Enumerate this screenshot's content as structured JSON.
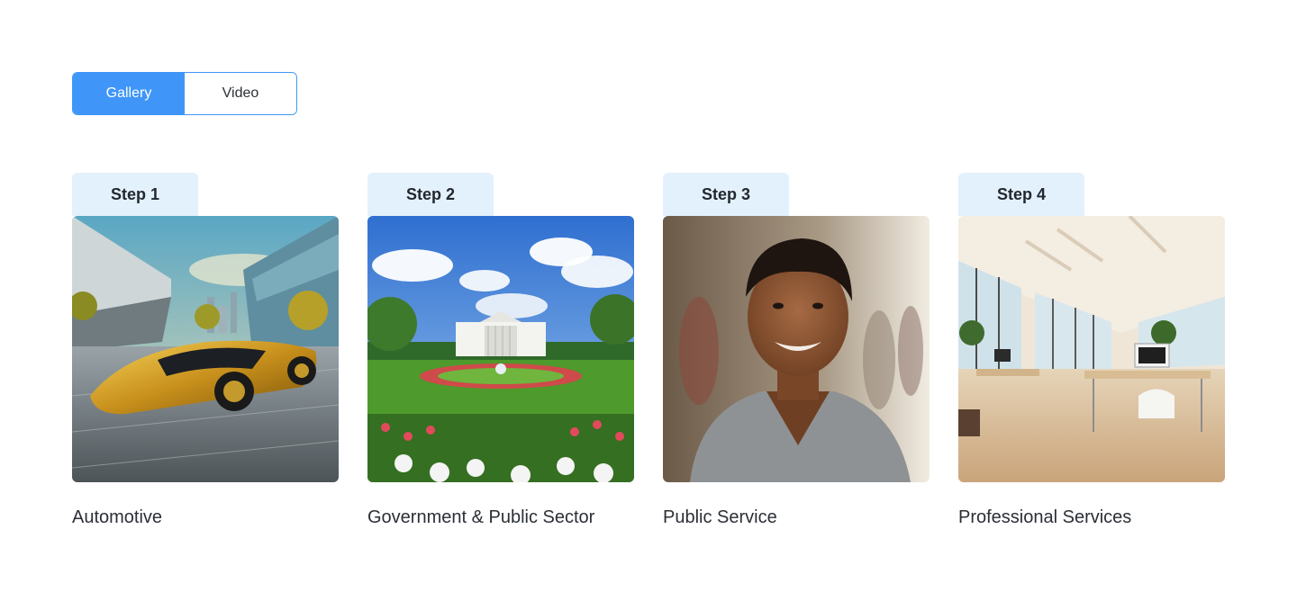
{
  "tabs": {
    "gallery_label": "Gallery",
    "video_label": "Video",
    "active": "Gallery"
  },
  "colors": {
    "accent": "#3f96f8",
    "step_tab_bg": "#e3f1fd",
    "text": "#2b2f36"
  },
  "cards": [
    {
      "step": "Step 1",
      "title": "Automotive",
      "image": "futuristic-gold-car-photo"
    },
    {
      "step": "Step 2",
      "title": "Government & Public Sector",
      "image": "government-building-garden-photo"
    },
    {
      "step": "Step 3",
      "title": "Public Service",
      "image": "smiling-man-portrait-photo"
    },
    {
      "step": "Step 4",
      "title": "Professional Services",
      "image": "bright-office-interior-photo"
    }
  ]
}
